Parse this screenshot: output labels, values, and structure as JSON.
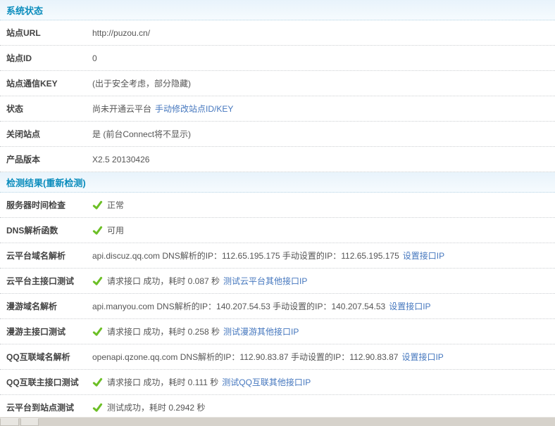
{
  "colors": {
    "header_text": "#0B8DBD",
    "header_bg": "#E8F3FB",
    "link_blue": "#4577BE",
    "check_green": "#6CBF26",
    "label_text": "#434343",
    "value_text": "#555555"
  },
  "section1": {
    "title": "系统状态",
    "rows": {
      "site_url": {
        "label": "站点URL",
        "value": "http://puzou.cn/"
      },
      "site_id": {
        "label": "站点ID",
        "value": "0"
      },
      "site_key": {
        "label": "站点通信KEY",
        "value": "(出于安全考虑，部分隐藏)"
      },
      "status": {
        "label": "状态",
        "value": "尚未开通云平台",
        "link": "手动修改站点ID/KEY"
      },
      "close_site": {
        "label": "关闭站点",
        "value": "是 (前台Connect将不显示)"
      },
      "product_version": {
        "label": "产品版本",
        "value": "X2.5 20130426"
      }
    }
  },
  "section2": {
    "title": "检测结果",
    "title_link": "(重新检测)",
    "rows": {
      "server_time": {
        "label": "服务器时间检查",
        "value": "正常"
      },
      "dns_func": {
        "label": "DNS解析函数",
        "value": "可用"
      },
      "cloud_dns": {
        "label": "云平台域名解析",
        "value": "api.discuz.qq.com DNS解析的IP：112.65.195.175 手动设置的IP：112.65.195.175",
        "link": "设置接口IP"
      },
      "cloud_api": {
        "label": "云平台主接口测试",
        "value": "请求接口 成功，耗时 0.087 秒",
        "link": "测试云平台其他接口IP"
      },
      "manyou_dns": {
        "label": "漫游域名解析",
        "value": "api.manyou.com DNS解析的IP：140.207.54.53 手动设置的IP：140.207.54.53",
        "link": "设置接口IP"
      },
      "manyou_api": {
        "label": "漫游主接口测试",
        "value": "请求接口 成功，耗时 0.258 秒",
        "link": "测试漫游其他接口IP"
      },
      "qq_dns": {
        "label": "QQ互联域名解析",
        "value": "openapi.qzone.qq.com DNS解析的IP：112.90.83.87 手动设置的IP：112.90.83.87",
        "link": "设置接口IP"
      },
      "qq_api": {
        "label": "QQ互联主接口测试",
        "value": "请求接口 成功，耗时 0.111 秒",
        "link": "测试QQ互联其他接口IP"
      },
      "cloud_to_site": {
        "label": "云平台到站点测试",
        "value": "测试成功，耗时 0.2942 秒"
      }
    }
  }
}
